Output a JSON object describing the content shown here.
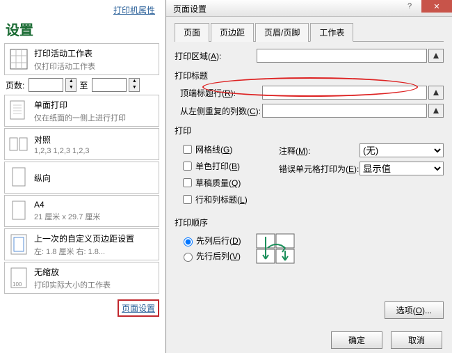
{
  "left": {
    "printer_properties": "打印机属性",
    "title": "设置",
    "opt1": {
      "t": "打印活动工作表",
      "s": "仅打印活动工作表"
    },
    "pages_label": "页数:",
    "pages_to": "至",
    "opt2": {
      "t": "单面打印",
      "s": "仅在纸面的一侧上进行打印"
    },
    "opt3": {
      "t": "对照",
      "s": "1,2,3    1,2,3    1,2,3"
    },
    "opt4": {
      "t": "纵向",
      "s": ""
    },
    "opt5": {
      "t": "A4",
      "s": "21 厘米 x 29.7 厘米"
    },
    "opt6": {
      "t": "上一次的自定义页边距设置",
      "s": "左: 1.8 厘米   右: 1.8..."
    },
    "opt7": {
      "t": "无缩放",
      "s": "打印实际大小的工作表"
    },
    "page_setup_link": "页面设置"
  },
  "dialog": {
    "title": "页面设置",
    "tabs": [
      "页面",
      "页边距",
      "页眉/页脚",
      "工作表"
    ],
    "active_tab": 3,
    "print_area_label": "打印区域(A):",
    "print_titles_label": "打印标题",
    "top_title_row_label": "顶端标题行(R):",
    "left_repeat_cols_label": "从左侧重复的列数(C):",
    "print_label": "打印",
    "cb_grid": "网格线(G)",
    "cb_mono": "单色打印(B)",
    "cb_draft": "草稿质量(Q)",
    "cb_rowcol": "行和列标题(L)",
    "notes_label": "注释(M):",
    "notes_value": "(无)",
    "errors_label": "错误单元格打印为(E):",
    "errors_value": "显示值",
    "order_label": "打印顺序",
    "order_down": "先列后行(D)",
    "order_over": "先行后列(V)",
    "options_btn": "选项(O)...",
    "ok": "确定",
    "cancel": "取消"
  }
}
